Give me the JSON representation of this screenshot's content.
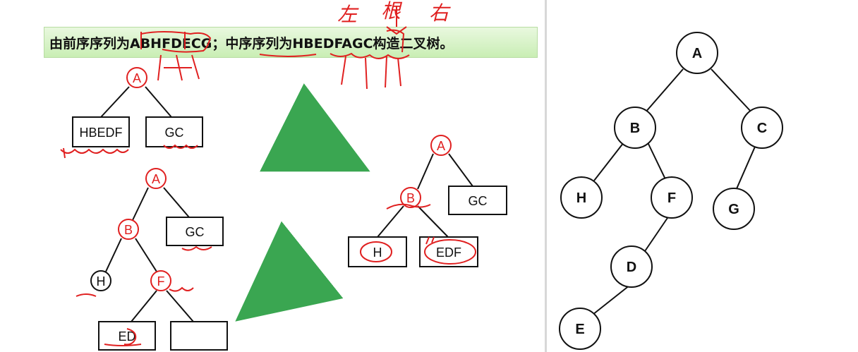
{
  "banner": {
    "text": "由前序序列为ABHFDECG；中序序列为HBEDFAGC构造二叉树。"
  },
  "annotations": {
    "left": "左",
    "root": "根",
    "right": "右"
  },
  "step1": {
    "root": "A",
    "left_box": "HBEDF",
    "right_box": "GC"
  },
  "step2": {
    "root": "A",
    "b": "B",
    "right_box": "GC",
    "h_box": "H",
    "edf_box": "EDF"
  },
  "step3": {
    "root": "A",
    "b": "B",
    "right_box": "GC",
    "h": "H",
    "f": "F",
    "ed_box": "ED",
    "empty_box": ""
  },
  "final_tree": {
    "a": "A",
    "b": "B",
    "c": "C",
    "h": "H",
    "f": "F",
    "g": "G",
    "d": "D",
    "e": "E"
  },
  "colors": {
    "red": "#e02020",
    "arrow": "#3aa651",
    "black": "#111111"
  }
}
